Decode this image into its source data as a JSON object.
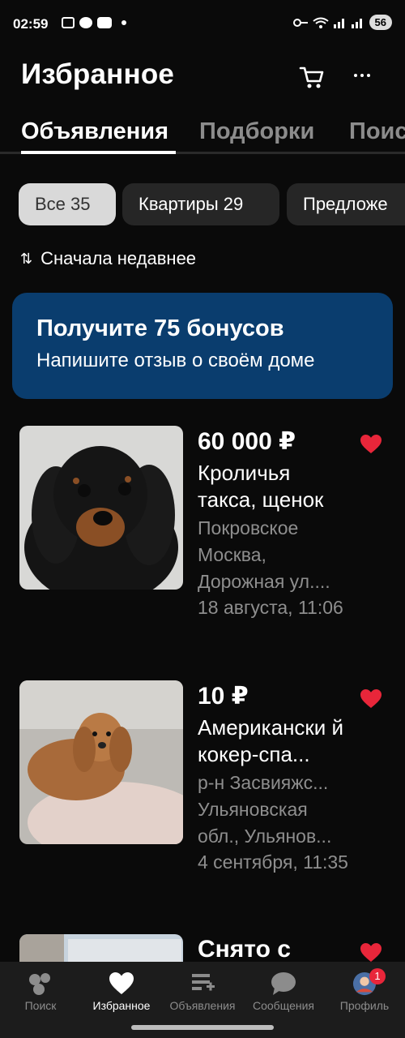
{
  "status_bar": {
    "time": "02:59",
    "battery": "56"
  },
  "header": {
    "title": "Избранное"
  },
  "tabs": [
    {
      "label": "Объявления",
      "active": true
    },
    {
      "label": "Подборки",
      "active": false
    },
    {
      "label": "Поис",
      "active": false
    }
  ],
  "chips": [
    {
      "label": "Все 35",
      "selected": true
    },
    {
      "label": "Квартиры 29",
      "selected": false
    },
    {
      "label": "Предложе",
      "selected": false
    }
  ],
  "sort": {
    "label": "Сначала недавнее"
  },
  "banner": {
    "title": "Получите 75 бонусов",
    "subtitle": "Напишите отзыв о своём доме"
  },
  "listings": [
    {
      "price": "60 000 ₽",
      "title": "Кроличья такса, щенок",
      "location": "Покровское Москва, Дорожная ул....",
      "date": "18 августа, 11:06",
      "favorite": true
    },
    {
      "price": "10 ₽",
      "title": "Американски й кокер-спа...",
      "location": "р-н Засвияжс... Ульяновская обл., Ульянов...",
      "date": "4 сентября, 11:35",
      "favorite": true
    },
    {
      "price": "Снято с",
      "title": "",
      "location": "",
      "date": "",
      "favorite": true
    }
  ],
  "bottom_nav": [
    {
      "label": "Поиск",
      "icon": "search-icon"
    },
    {
      "label": "Избранное",
      "icon": "heart-icon",
      "active": true
    },
    {
      "label": "Объявления",
      "icon": "ads-icon"
    },
    {
      "label": "Сообщения",
      "icon": "chat-icon"
    },
    {
      "label": "Профиль",
      "icon": "avatar",
      "badge": "1"
    }
  ],
  "colors": {
    "accent_red": "#e8263a",
    "banner_bg": "#0a3d6e"
  }
}
